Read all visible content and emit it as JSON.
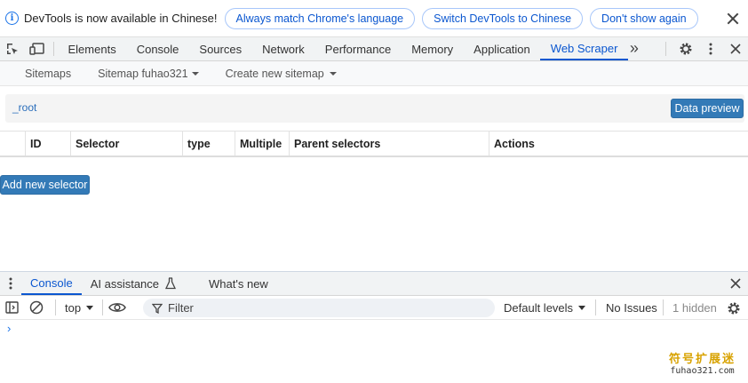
{
  "infobar": {
    "message": "DevTools is now available in Chinese!",
    "buttons": [
      "Always match Chrome's language",
      "Switch DevTools to Chinese",
      "Don't show again"
    ],
    "info_icon": "info-icon",
    "close_icon": "close-icon"
  },
  "tabbar": {
    "tabs": [
      "Elements",
      "Console",
      "Sources",
      "Network",
      "Performance",
      "Memory",
      "Application",
      "Web Scraper"
    ],
    "active_tab": "Web Scraper",
    "more_glyph": "»",
    "more_icon": "double-chevron-icon"
  },
  "scraper_nav": {
    "sitemaps": "Sitemaps",
    "sitemap_current": "Sitemap fuhao321",
    "create": "Create new sitemap"
  },
  "breadcrumb": {
    "root": "_root",
    "data_preview": "Data preview"
  },
  "selector_table": {
    "headers": [
      "ID",
      "Selector",
      "type",
      "Multiple",
      "Parent selectors",
      "Actions"
    ],
    "rows": []
  },
  "add_selector": "Add new selector",
  "drawer": {
    "tabs": [
      "Console",
      "AI assistance",
      "What's new"
    ],
    "active_tab": "Console"
  },
  "console_toolbar": {
    "context": "top",
    "filter_placeholder": "Filter",
    "levels": "Default levels",
    "issues": "No Issues",
    "hidden": "1 hidden"
  },
  "console": {
    "prompt": "›"
  },
  "watermark": {
    "cn": "符号扩展迷",
    "en": "fuhao321.com"
  },
  "colors": {
    "accent": "#0b57d0",
    "button_blue": "#337ab7",
    "link": "#2a6ebb"
  }
}
